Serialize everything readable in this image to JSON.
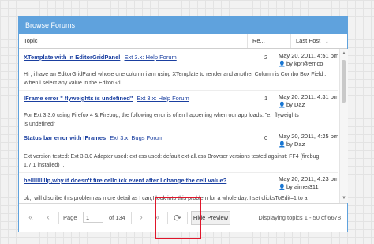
{
  "panel": {
    "title": "Browse Forums"
  },
  "columns": {
    "topic": "Topic",
    "replies": "Re...",
    "last_post": "Last Post",
    "sort_indicator": "↓"
  },
  "rows": [
    {
      "title": "XTemplate with in EditorGridPanel",
      "forum": "Ext 3.x: Help Forum",
      "replies": "2",
      "date": "May 20, 2011, 4:51 pm",
      "by": "by kpr@emco",
      "preview": [
        "Hi , i have an EditorGridPanel whose one column i am using XTemplate to render and another Column is Combo Box Field .",
        "When i select any value in the EditorGri..."
      ]
    },
    {
      "title": "IFrame error \" flyweights is undefined\"",
      "forum": "Ext 3.x: Help Forum",
      "replies": "1",
      "date": "May 20, 2011, 4:31 pm",
      "by": "by Daz",
      "preview": [
        "For Ext 3.3.0 using Firefox 4 & Firebug, the following error is often happening when our app loads: \"e._flyweights",
        "is undefined\""
      ]
    },
    {
      "title": "Status bar error with IFrames",
      "forum": "Ext 3.x: Bugs Forum",
      "replies": "0",
      "date": "May 20, 2011, 4:25 pm",
      "by": "by Daz",
      "preview": [
        "Ext version tested: Ext 3.3.0 Adapter used: ext css used: default ext-all.css Browser versions tested against: FF4 (firebug",
        "1.7.1 installed) ..."
      ]
    },
    {
      "title": "hellllllllllp,why it doesn't fire cellclick event after I change the cell value?",
      "forum": "",
      "replies": "",
      "date": "May 20, 2011, 4:23 pm",
      "by": "by aimer311",
      "preview": [
        "ok,I will discribe this problem as more detail as I can,I look into this problem for a whole day. I set clicksToEdit=1 to a"
      ]
    }
  ],
  "pager": {
    "page_label": "Page",
    "page_value": "1",
    "of_label": "of 134",
    "hide_preview": "Hide Preview",
    "display_text": "Displaying topics 1 - 50 of 6678"
  },
  "icons": {
    "first": "«",
    "prev": "‹",
    "next": "›",
    "last": "»",
    "refresh": "⟳",
    "user": "👤",
    "scroll_up": "▲",
    "scroll_down": "▼"
  },
  "colors": {
    "accent": "#5fa2dd",
    "link": "#1a3fa0",
    "highlight": "#e0162b"
  }
}
